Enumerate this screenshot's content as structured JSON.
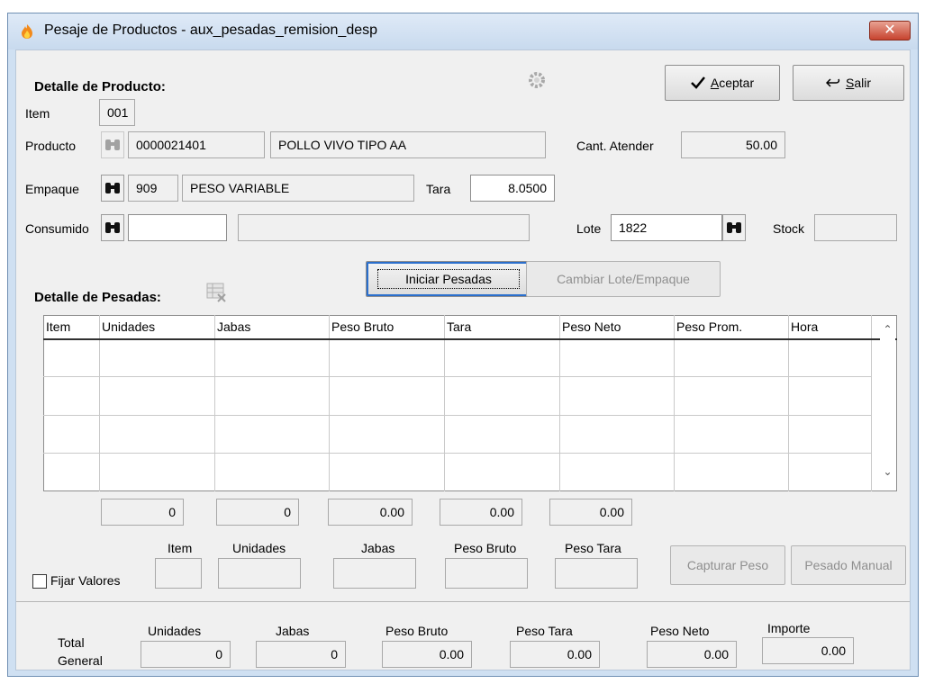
{
  "window": {
    "title": "Pesaje de Productos - aux_pesadas_remision_desp",
    "close_label": "✕"
  },
  "producto": {
    "section_title": "Detalle de Producto:",
    "item_label": "Item",
    "item_value": "001",
    "producto_label": "Producto",
    "producto_code": "0000021401",
    "producto_name": "POLLO VIVO TIPO AA",
    "cant_label": "Cant. Atender",
    "cant_value": "50.00",
    "empaque_label": "Empaque",
    "empaque_code": "909",
    "empaque_name": "PESO VARIABLE",
    "tara_label": "Tara",
    "tara_value": "8.0500",
    "consumido_label": "Consumido",
    "consumido_code": "",
    "consumido_name": "",
    "lote_label": "Lote",
    "lote_value": "1822",
    "stock_label": "Stock",
    "stock_value": ""
  },
  "buttons": {
    "aceptar_pre": "",
    "aceptar_key": "A",
    "aceptar_rest": "ceptar",
    "salir_key": "S",
    "salir_rest": "alir",
    "iniciar": "Iniciar Pesadas",
    "cambiar": "Cambiar Lote/Empaque",
    "capturar": "Capturar Peso",
    "manual": "Pesado Manual"
  },
  "pesadas": {
    "section_title": "Detalle de Pesadas:",
    "columns": [
      "Item",
      "Unidades",
      "Jabas",
      "Peso Bruto",
      "Tara",
      "Peso Neto",
      "Peso Prom.",
      "Hora"
    ],
    "totals": [
      "0",
      "0",
      "0.00",
      "0.00",
      "0.00"
    ]
  },
  "entry": {
    "fijar_label": "Fijar Valores",
    "labels": [
      "Item",
      "Unidades",
      "Jabas",
      "Peso Bruto",
      "Peso Tara"
    ],
    "values": [
      "",
      "",
      "",
      "",
      ""
    ]
  },
  "total_general": {
    "label_1": "Total",
    "label_2": "General",
    "labels": [
      "Unidades",
      "Jabas",
      "Peso Bruto",
      "Peso Tara",
      "Peso Neto",
      "Importe"
    ],
    "values": [
      "0",
      "0",
      "0.00",
      "0.00",
      "0.00",
      "0.00"
    ]
  }
}
